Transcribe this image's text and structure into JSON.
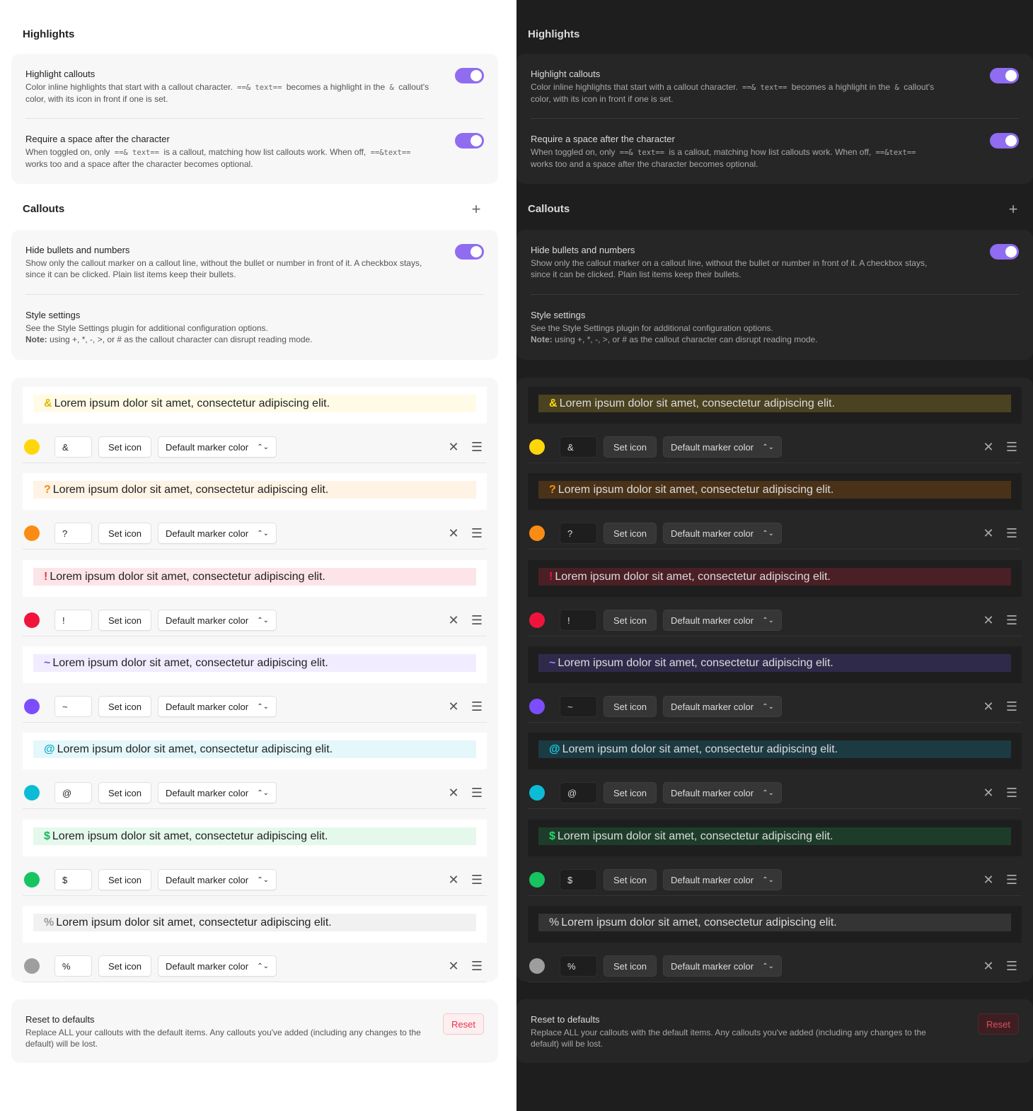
{
  "highlights": {
    "heading": "Highlights",
    "callouts_setting": {
      "name": "Highlight callouts",
      "desc_1": "Color inline highlights that start with a callout character.",
      "code_1": "==& text==",
      "desc_2": "becomes a highlight in the",
      "code_2": "&",
      "desc_3": "callout's color, with its icon in front if one is set."
    },
    "space_setting": {
      "name": "Require a space after the character",
      "desc_1": "When toggled on, only",
      "code_1": "==& text==",
      "desc_2": "is a callout, matching how list callouts work. When off,",
      "code_2": "==&text==",
      "desc_3": "works too and a space after the character becomes optional."
    }
  },
  "callouts": {
    "heading": "Callouts",
    "add_icon": "plus-icon",
    "hide_bullets": {
      "name": "Hide bullets and numbers",
      "desc": "Show only the callout marker on a callout line, without the bullet or number in front of it. A checkbox stays, since it can be clicked. Plain list items keep their bullets."
    },
    "style_settings": {
      "name": "Style settings",
      "desc": "See the Style Settings plugin for additional configuration options.",
      "note_label": "Note:",
      "note": "using +, *, -, >, or # as the callout character can disrupt reading mode."
    }
  },
  "callout_items": [
    {
      "char": "&",
      "text": "Lorem ipsum dolor sit amet, consectetur adipiscing elit.",
      "color": "#ffd60a",
      "light_bg": "#fffbe6",
      "dark_bg": "#4a4221",
      "light_mark": "#e6b800",
      "dark_mark": "#ffd60a",
      "set_icon": "Set icon",
      "marker": "Default marker color"
    },
    {
      "char": "?",
      "text": "Lorem ipsum dolor sit amet, consectetur adipiscing elit.",
      "color": "#fb8c13",
      "light_bg": "#fff3e5",
      "dark_bg": "#4a3219",
      "light_mark": "#f08a17",
      "dark_mark": "#fb8c13",
      "set_icon": "Set icon",
      "marker": "Default marker color"
    },
    {
      "char": "!",
      "text": "Lorem ipsum dolor sit amet, consectetur adipiscing elit.",
      "color": "#f0143c",
      "light_bg": "#fde4e8",
      "dark_bg": "#4a1f25",
      "light_mark": "#e9334a",
      "dark_mark": "#f0143c",
      "set_icon": "Set icon",
      "marker": "Default marker color"
    },
    {
      "char": "~",
      "text": "Lorem ipsum dolor sit amet, consectetur adipiscing elit.",
      "color": "#7c4dff",
      "light_bg": "#f1ecff",
      "dark_bg": "#302a4a",
      "light_mark": "#7c4dff",
      "dark_mark": "#9d7bff",
      "set_icon": "Set icon",
      "marker": "Default marker color"
    },
    {
      "char": "@",
      "text": "Lorem ipsum dolor sit amet, consectetur adipiscing elit.",
      "color": "#0cbcd6",
      "light_bg": "#e4f7fb",
      "dark_bg": "#1c3a42",
      "light_mark": "#0cb0c8",
      "dark_mark": "#1ad2ec",
      "set_icon": "Set icon",
      "marker": "Default marker color"
    },
    {
      "char": "$",
      "text": "Lorem ipsum dolor sit amet, consectetur adipiscing elit.",
      "color": "#16c460",
      "light_bg": "#e4f8ec",
      "dark_bg": "#1d3d2a",
      "light_mark": "#16b45a",
      "dark_mark": "#27d86e",
      "set_icon": "Set icon",
      "marker": "Default marker color"
    },
    {
      "char": "%",
      "text": "Lorem ipsum dolor sit amet, consectetur adipiscing elit.",
      "color": "#9e9e9e",
      "light_bg": "#f1f1f1",
      "dark_bg": "#343434",
      "light_mark": "#999999",
      "dark_mark": "#aaaaaa",
      "set_icon": "Set icon",
      "marker": "Default marker color"
    }
  ],
  "reset": {
    "name": "Reset to defaults",
    "desc": "Replace ALL your callouts with the default items. Any callouts you've added (including any changes to the default) will be lost.",
    "button": "Reset"
  },
  "colors": {
    "accent": "#8f6cf0"
  }
}
